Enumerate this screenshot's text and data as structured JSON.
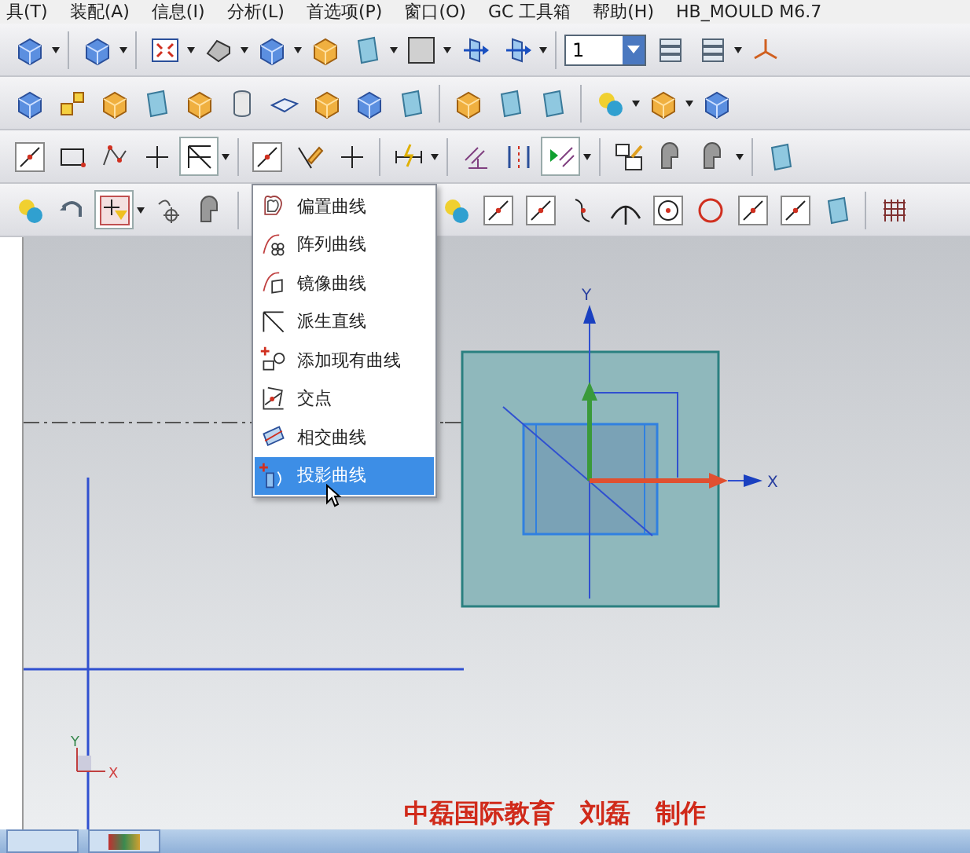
{
  "menubar": [
    "具(T)",
    "装配(A)",
    "信息(I)",
    "分析(L)",
    "首选项(P)",
    "窗口(O)",
    "GC 工具箱",
    "帮助(H)",
    "HB_MOULD M6.7"
  ],
  "toolbar": {
    "layer_field": {
      "value": "1"
    }
  },
  "dropdown_menu": [
    {
      "label": "偏置曲线",
      "kind": "offset",
      "selected": false
    },
    {
      "label": "阵列曲线",
      "kind": "pattern",
      "selected": false
    },
    {
      "label": "镜像曲线",
      "kind": "mirror",
      "selected": false
    },
    {
      "label": "派生直线",
      "kind": "derived",
      "selected": false
    },
    {
      "label": "添加现有曲线",
      "kind": "add",
      "selected": false
    },
    {
      "label": "交点",
      "kind": "intersection",
      "selected": false
    },
    {
      "label": "相交曲线",
      "kind": "intersect",
      "selected": false
    },
    {
      "label": "投影曲线",
      "kind": "project",
      "selected": true
    }
  ],
  "viewport": {
    "axis_labels": {
      "y": "Y",
      "x": "X"
    },
    "triad_labels": {
      "y": "Y",
      "x": "X"
    },
    "caption": "中磊国际教育　刘磊　制作"
  }
}
